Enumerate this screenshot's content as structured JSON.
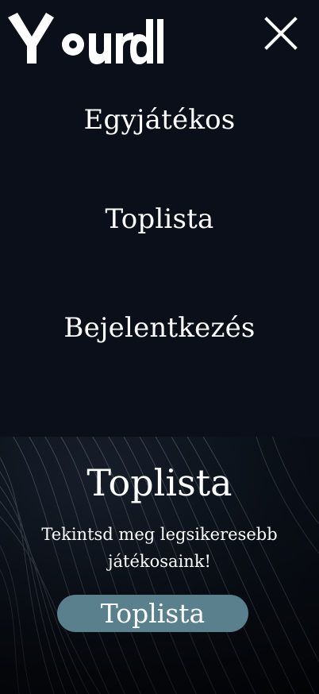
{
  "header": {
    "logo_text": "Yourdle",
    "close_icon": "close-icon"
  },
  "menu": {
    "items": [
      {
        "label": "Egyjátékos"
      },
      {
        "label": "Toplista"
      },
      {
        "label": "Bejelentkezés"
      }
    ]
  },
  "promo": {
    "title": "Toplista",
    "text": "Tekintsd meg legsikeresebb játékosaink!",
    "button_label": "Toplista"
  },
  "colors": {
    "background": "#0a0f1a",
    "button": "#5a7f8d",
    "text": "#ffffff"
  }
}
